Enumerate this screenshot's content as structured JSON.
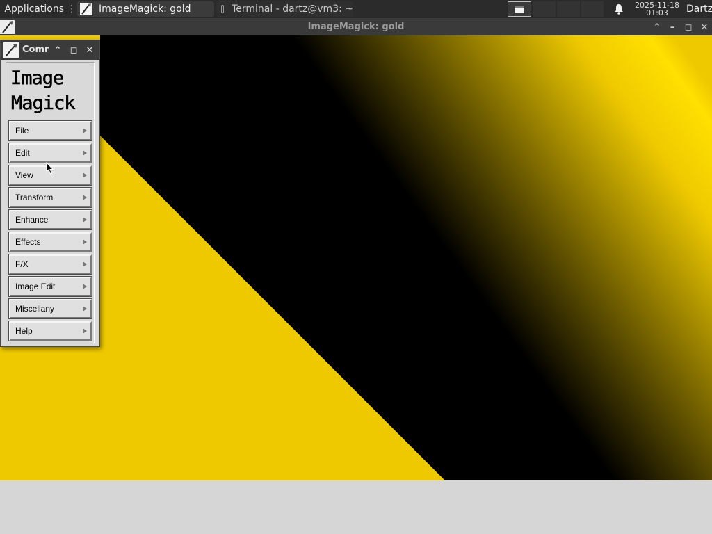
{
  "panel": {
    "applications_label": "Applications",
    "tasks": [
      {
        "label": "ImageMagick: gold",
        "icon": "imagemagick-wand-icon",
        "active": true
      },
      {
        "label": "Terminal - dartz@vm3: ~",
        "icon": "terminal-icon",
        "active": false
      }
    ],
    "clock_date": "2025-11-18",
    "clock_time": "01:03",
    "user": "Dartz"
  },
  "main_window": {
    "title": "ImageMagick: gold",
    "controls": {
      "collapse": "⌃",
      "minimize": "–",
      "maximize": "◻",
      "close": "✕"
    },
    "image": {
      "description_colors": {
        "background": "#eec900",
        "shadow": "#000000",
        "highlight": "#ffe000"
      }
    }
  },
  "command_widget": {
    "title": "Comn",
    "logo_lines": [
      "Image",
      "Magick"
    ],
    "controls": {
      "collapse": "⌃",
      "maximize": "◻",
      "close": "✕"
    },
    "menu": [
      {
        "label": "File"
      },
      {
        "label": "Edit"
      },
      {
        "label": "View"
      },
      {
        "label": "Transform"
      },
      {
        "label": "Enhance"
      },
      {
        "label": "Effects"
      },
      {
        "label": "F/X"
      },
      {
        "label": "Image Edit"
      },
      {
        "label": "Miscellany"
      },
      {
        "label": "Help"
      }
    ]
  },
  "colors": {
    "panel_bg": "#2b2b2b",
    "titlebar_bg": "#3a3a3a",
    "gold": "#eec900",
    "desktop_bg": "#d6d6d6"
  }
}
